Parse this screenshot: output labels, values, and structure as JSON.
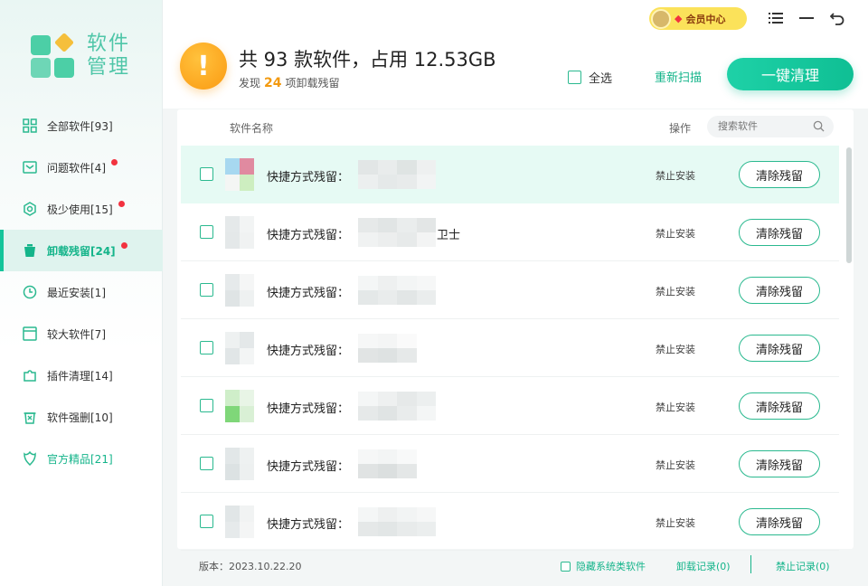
{
  "app": {
    "logo_line1": "软件",
    "logo_line2": "管理"
  },
  "sidebar": {
    "items": [
      {
        "label": "全部软件[93]",
        "icon": "grid-icon",
        "dot": false
      },
      {
        "label": "问题软件[4]",
        "icon": "mail-warning-icon",
        "dot": true
      },
      {
        "label": "极少使用[15]",
        "icon": "hexagon-gear-icon",
        "dot": true
      },
      {
        "label": "卸载残留[24]",
        "icon": "trash-icon",
        "dot": true
      },
      {
        "label": "最近安装[1]",
        "icon": "clock-icon",
        "dot": false
      },
      {
        "label": "较大软件[7]",
        "icon": "window-icon",
        "dot": false
      },
      {
        "label": "插件清理[14]",
        "icon": "puzzle-icon",
        "dot": false
      },
      {
        "label": "软件强删[10]",
        "icon": "delete-bin-icon",
        "dot": false
      },
      {
        "label": "官方精品[21]",
        "icon": "crown-icon",
        "dot": false
      }
    ],
    "active_index": 3
  },
  "header": {
    "title": "共 93 款软件，占用 12.53GB",
    "sub_prefix": "发现",
    "sub_count": "24",
    "sub_suffix": "项卸载残留",
    "vip_label": "会员中心",
    "select_all": "全选",
    "rescan": "重新扫描",
    "clean": "一键清理"
  },
  "table": {
    "col_name": "软件名称",
    "col_op": "操作",
    "search_placeholder": "搜索软件",
    "rows": [
      {
        "label": "快捷方式残留：",
        "suffix": "",
        "forbid": "禁止安装",
        "action": "清除残留"
      },
      {
        "label": "快捷方式残留：",
        "suffix": "卫士",
        "forbid": "禁止安装",
        "action": "清除残留"
      },
      {
        "label": "快捷方式残留：",
        "suffix": "",
        "forbid": "禁止安装",
        "action": "清除残留"
      },
      {
        "label": "快捷方式残留：",
        "suffix": "",
        "forbid": "禁止安装",
        "action": "清除残留"
      },
      {
        "label": "快捷方式残留：",
        "suffix": "",
        "forbid": "禁止安装",
        "action": "清除残留"
      },
      {
        "label": "快捷方式残留：",
        "suffix": "",
        "forbid": "禁止安装",
        "action": "清除残留"
      },
      {
        "label": "快捷方式残留：",
        "suffix": "",
        "forbid": "禁止安装",
        "action": "清除残留"
      }
    ]
  },
  "footer": {
    "version": "版本：2023.10.22.20",
    "hide_system": "隐藏系统类软件",
    "uninstall_log": "卸载记录(0)",
    "ban_log": "禁止记录(0)"
  },
  "colors": {
    "accent": "#14b48a",
    "warning": "#fb9a12",
    "dot": "#f2323f"
  }
}
